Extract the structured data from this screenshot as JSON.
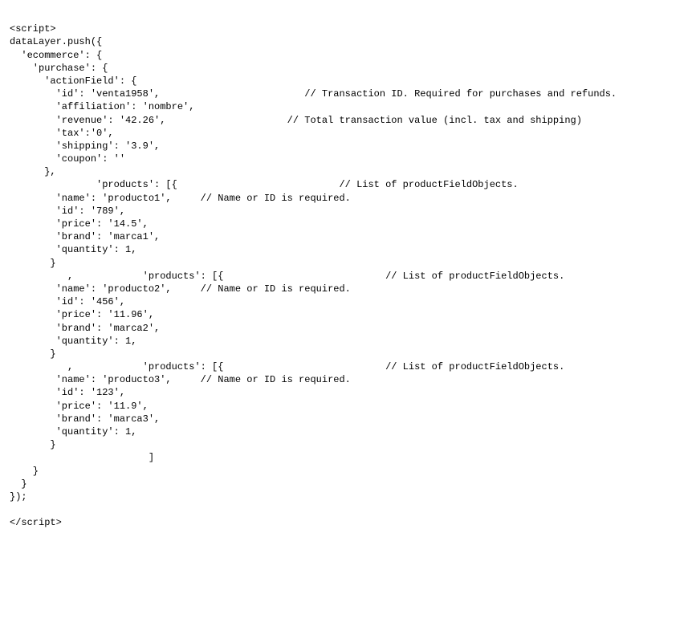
{
  "lines": [
    "<script>",
    "dataLayer.push({",
    "  'ecommerce': {",
    "    'purchase': {",
    "      'actionField': {",
    "        'id': 'venta1958',                         // Transaction ID. Required for purchases and refunds.",
    "        'affiliation': 'nombre',",
    "        'revenue': '42.26',                     // Total transaction value (incl. tax and shipping)",
    "        'tax':'0',",
    "        'shipping': '3.9',",
    "        'coupon': ''",
    "      },",
    "               'products': [{                            // List of productFieldObjects.",
    "        'name': 'producto1',     // Name or ID is required.",
    "        'id': '789',",
    "        'price': '14.5',",
    "        'brand': 'marca1',",
    "        'quantity': 1,",
    "       }",
    "          ,            'products': [{                            // List of productFieldObjects.",
    "        'name': 'producto2',     // Name or ID is required.",
    "        'id': '456',",
    "        'price': '11.96',",
    "        'brand': 'marca2',",
    "        'quantity': 1,",
    "       }",
    "          ,            'products': [{                            // List of productFieldObjects.",
    "        'name': 'producto3',     // Name or ID is required.",
    "        'id': '123',",
    "        'price': '11.9',",
    "        'brand': 'marca3',",
    "        'quantity': 1,",
    "       }",
    "                        ]",
    "    }",
    "  }",
    "});",
    "",
    "</script>",
    "",
    ""
  ]
}
